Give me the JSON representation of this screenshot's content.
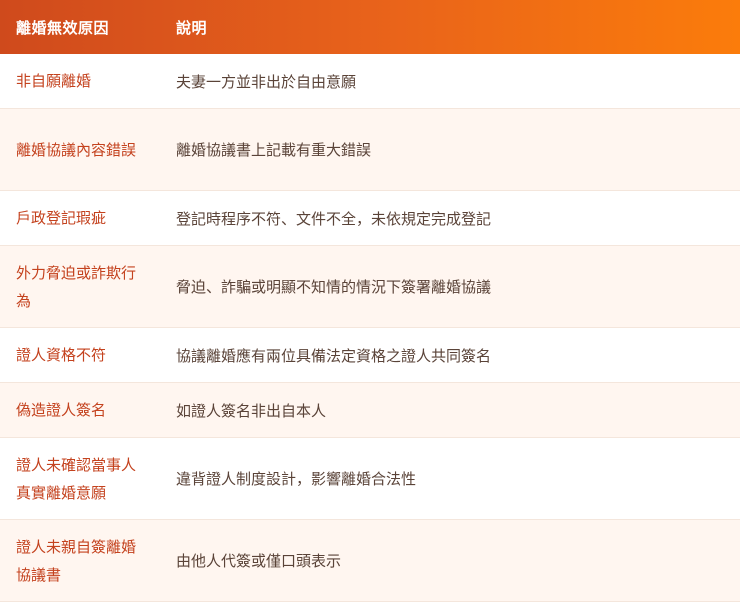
{
  "table": {
    "headers": [
      "離婚無效原因",
      "說明"
    ],
    "rows": [
      {
        "reason": "非自願離婚",
        "description": "夫妻一方並非出於自由意願"
      },
      {
        "reason": "離婚協議內容錯誤",
        "description": "離婚協議書上記載有重大錯誤"
      },
      {
        "reason": "戶政登記瑕疵",
        "description": "登記時程序不符、文件不全，未依規定完成登記"
      },
      {
        "reason": "外力脅迫或詐欺行為",
        "description": "脅迫、詐騙或明顯不知情的情況下簽署離婚協議"
      },
      {
        "reason": "證人資格不符",
        "description": "協議離婚應有兩位具備法定資格之證人共同簽名"
      },
      {
        "reason": "偽造證人簽名",
        "description": "如證人簽名非出自本人"
      },
      {
        "reason": "證人未確認當事人真實離婚意願",
        "description": "違背證人制度設計，影響離婚合法性"
      },
      {
        "reason": "證人未親自簽離婚協議書",
        "description": "由他人代簽或僅口頭表示"
      }
    ]
  },
  "colors": {
    "header_start": "#cf4a1c",
    "header_end": "#fb7c0b",
    "reason_text": "#c4421e",
    "description_text": "#5a4338",
    "row_alt": "#fff6f0"
  }
}
